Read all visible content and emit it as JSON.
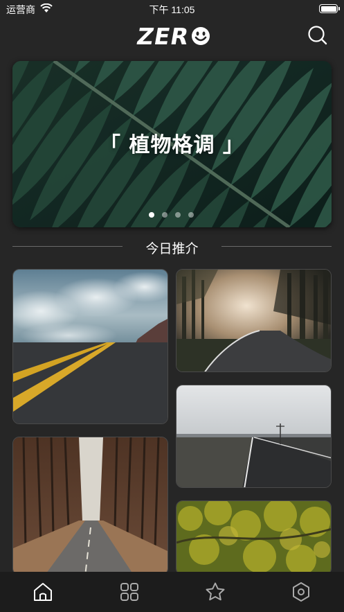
{
  "status_bar": {
    "carrier": "运营商",
    "time": "下午 11:05"
  },
  "header": {
    "logo_text": "ZER"
  },
  "banner": {
    "title": "「 植物格调 」",
    "page_count": 4,
    "active_page": 1
  },
  "section": {
    "title": "今日推介"
  },
  "cards": [
    {
      "subject": "road-sky"
    },
    {
      "subject": "misty-forest-road"
    },
    {
      "subject": "grey-coastal-road"
    },
    {
      "subject": "autumn-forest-road"
    },
    {
      "subject": "yellow-foliage"
    }
  ],
  "tabs": [
    {
      "name": "home",
      "active": true
    },
    {
      "name": "categories",
      "active": false
    },
    {
      "name": "favorites",
      "active": false
    },
    {
      "name": "settings",
      "active": false
    }
  ]
}
